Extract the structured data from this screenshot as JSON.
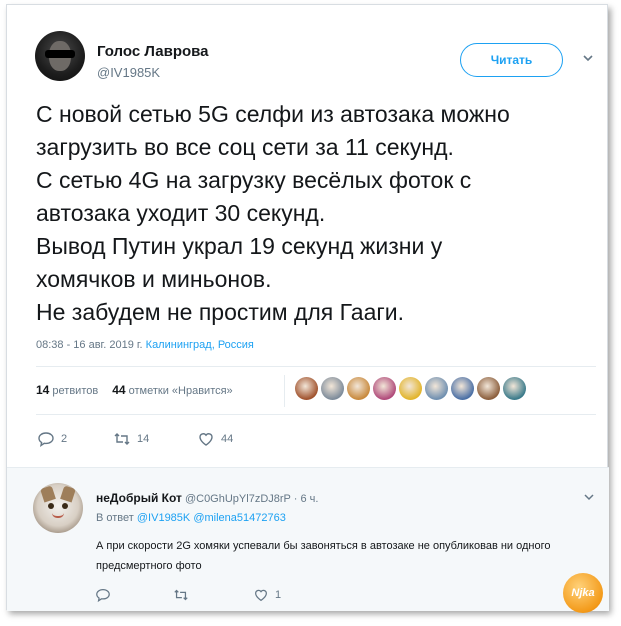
{
  "tweet": {
    "author_name": "Голос Лаврова",
    "author_handle": "@IV1985K",
    "follow_label": "Читать",
    "text_lines": [
      "С новой сетью 5G селфи из автозака можно",
      "загрузить во все соц сети за 11 секунд.",
      "С сетью 4G на загрузку весёлых фоток с",
      "автозака уходит 30 секунд.",
      "Вывод Путин украл 19 секунд жизни у",
      "хомячков и миньонов.",
      "Не забудем не простим для Гааги."
    ],
    "timestamp": "08:38 - 16 авг. 2019 г.",
    "location": "Калининград, Россия",
    "retweets_count": "14",
    "retweets_label": "ретвитов",
    "likes_count": "44",
    "likes_label": "отметки «Нравится»",
    "actions": {
      "reply_count": "2",
      "retweet_count": "14",
      "like_count": "44"
    },
    "liker_colors": [
      "#a0522d",
      "#7d8b9a",
      "#c8893c",
      "#b04a7a",
      "#e2b42a",
      "#6f8fb0",
      "#4a6fa5",
      "#8b5e3c",
      "#3a7a8a"
    ]
  },
  "reply": {
    "author_name": "неДобрый Кот",
    "author_handle": "@C0GhUpYl7zDJ8rP",
    "time": "· 6 ч.",
    "in_reply_prefix": "В ответ",
    "in_reply_mention1": "@IV1985K",
    "in_reply_mention2": "@milena51472763",
    "text": "А при скорости 2G хомяки успевали бы завоняться в автозаке не опубликовав ни одного предсмертного фото",
    "like_count": "1"
  },
  "watermark": "Njka",
  "colors": {
    "accent": "#1da1f2",
    "muted": "#657786",
    "text": "#14171a"
  }
}
